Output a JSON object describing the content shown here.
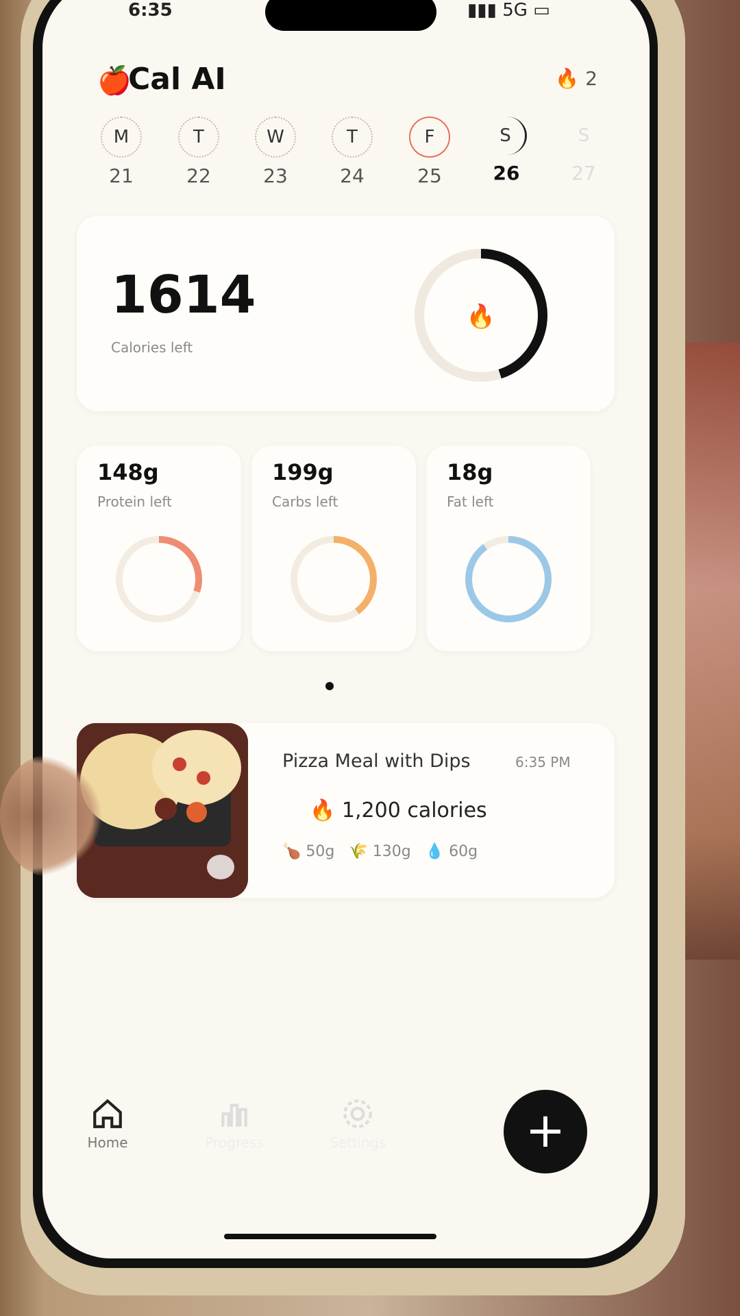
{
  "status": {
    "time": "6:35",
    "network": "5G",
    "battery_icon": "battery-icon"
  },
  "app": {
    "title": "Cal AI",
    "streak": "2"
  },
  "week": [
    {
      "letter": "M",
      "date": "21"
    },
    {
      "letter": "T",
      "date": "22"
    },
    {
      "letter": "W",
      "date": "23"
    },
    {
      "letter": "T",
      "date": "24"
    },
    {
      "letter": "F",
      "date": "25"
    },
    {
      "letter": "S",
      "date": "26"
    },
    {
      "letter": "S",
      "date": "27"
    }
  ],
  "calories": {
    "value": "1614",
    "label": "Calories left",
    "progress": 0.45
  },
  "macros": [
    {
      "value": "148g",
      "label": "Protein left",
      "color": "#ef8d74",
      "progress": 0.3
    },
    {
      "value": "199g",
      "label": "Carbs left",
      "color": "#f4b06a",
      "progress": 0.4
    },
    {
      "value": "18g",
      "label": "Fat left",
      "color": "#9cc8e8",
      "progress": 0.9
    }
  ],
  "meal": {
    "name": "Pizza Meal with Dips",
    "time": "6:35 PM",
    "calories": "1,200 calories",
    "protein": "50g",
    "carbs": "130g",
    "fat": "60g"
  },
  "nav": {
    "home": "Home",
    "progress": "Progress",
    "settings": "Settings"
  },
  "fab_label": "+"
}
